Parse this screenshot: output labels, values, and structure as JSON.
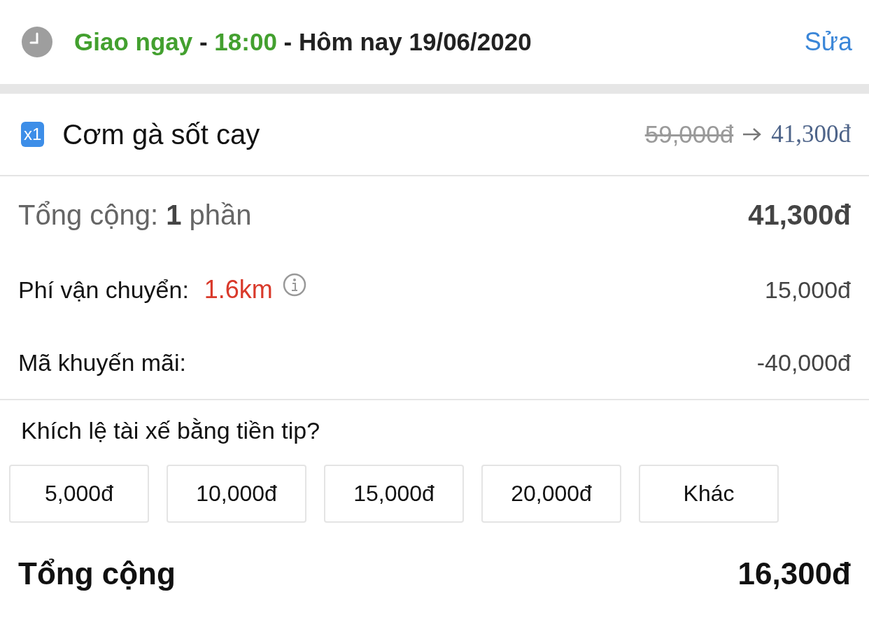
{
  "header": {
    "parts": [
      {
        "text": "Giao ngay",
        "kind": "accent"
      },
      {
        "text": " - ",
        "kind": "plain"
      },
      {
        "text": "18:00",
        "kind": "accent"
      },
      {
        "text": " - Hôm nay 19/06/2020",
        "kind": "plain"
      }
    ],
    "edit_link": "Sửa"
  },
  "items": [
    {
      "quantity": "x1",
      "name": "Cơm gà sốt cay",
      "original_price": "59,000đ",
      "price": "41,300đ"
    }
  ],
  "summary": {
    "label": "Tổng cộng: **1** phần",
    "value": "41,300đ"
  },
  "fees": [
    {
      "label": "Phí vận chuyển:",
      "distance": "1.6km",
      "value": "15,000đ"
    },
    {
      "label": "Mã khuyến mãi:",
      "value": "-40,000đ"
    }
  ],
  "tip": {
    "question": "Khích lệ tài xế bằng tiền tip?",
    "options": [
      "5,000đ",
      "10,000đ",
      "15,000đ",
      "20,000đ",
      "Khác"
    ]
  },
  "total": {
    "label": "Tổng cộng",
    "value": "16,300đ"
  }
}
